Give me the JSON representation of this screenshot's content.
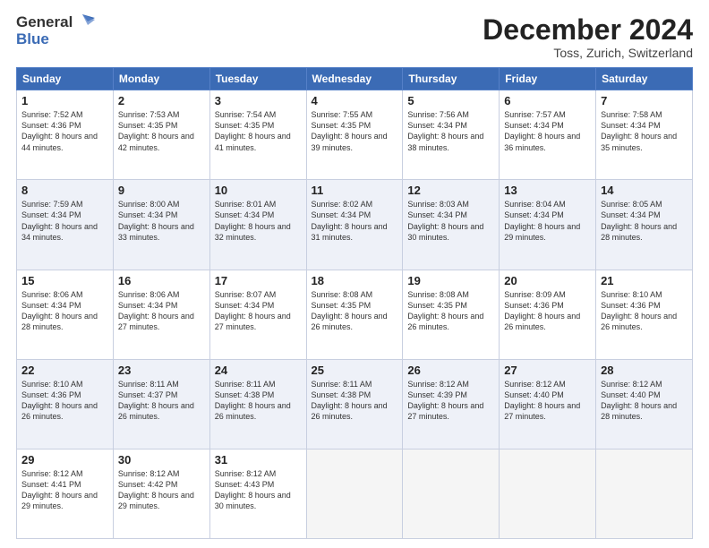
{
  "logo": {
    "line1": "General",
    "line2": "Blue"
  },
  "header": {
    "month": "December 2024",
    "location": "Toss, Zurich, Switzerland"
  },
  "weekdays": [
    "Sunday",
    "Monday",
    "Tuesday",
    "Wednesday",
    "Thursday",
    "Friday",
    "Saturday"
  ],
  "weeks": [
    [
      {
        "day": "1",
        "sunrise": "7:52 AM",
        "sunset": "4:36 PM",
        "daylight": "8 hours and 44 minutes."
      },
      {
        "day": "2",
        "sunrise": "7:53 AM",
        "sunset": "4:35 PM",
        "daylight": "8 hours and 42 minutes."
      },
      {
        "day": "3",
        "sunrise": "7:54 AM",
        "sunset": "4:35 PM",
        "daylight": "8 hours and 41 minutes."
      },
      {
        "day": "4",
        "sunrise": "7:55 AM",
        "sunset": "4:35 PM",
        "daylight": "8 hours and 39 minutes."
      },
      {
        "day": "5",
        "sunrise": "7:56 AM",
        "sunset": "4:34 PM",
        "daylight": "8 hours and 38 minutes."
      },
      {
        "day": "6",
        "sunrise": "7:57 AM",
        "sunset": "4:34 PM",
        "daylight": "8 hours and 36 minutes."
      },
      {
        "day": "7",
        "sunrise": "7:58 AM",
        "sunset": "4:34 PM",
        "daylight": "8 hours and 35 minutes."
      }
    ],
    [
      {
        "day": "8",
        "sunrise": "7:59 AM",
        "sunset": "4:34 PM",
        "daylight": "8 hours and 34 minutes."
      },
      {
        "day": "9",
        "sunrise": "8:00 AM",
        "sunset": "4:34 PM",
        "daylight": "8 hours and 33 minutes."
      },
      {
        "day": "10",
        "sunrise": "8:01 AM",
        "sunset": "4:34 PM",
        "daylight": "8 hours and 32 minutes."
      },
      {
        "day": "11",
        "sunrise": "8:02 AM",
        "sunset": "4:34 PM",
        "daylight": "8 hours and 31 minutes."
      },
      {
        "day": "12",
        "sunrise": "8:03 AM",
        "sunset": "4:34 PM",
        "daylight": "8 hours and 30 minutes."
      },
      {
        "day": "13",
        "sunrise": "8:04 AM",
        "sunset": "4:34 PM",
        "daylight": "8 hours and 29 minutes."
      },
      {
        "day": "14",
        "sunrise": "8:05 AM",
        "sunset": "4:34 PM",
        "daylight": "8 hours and 28 minutes."
      }
    ],
    [
      {
        "day": "15",
        "sunrise": "8:06 AM",
        "sunset": "4:34 PM",
        "daylight": "8 hours and 28 minutes."
      },
      {
        "day": "16",
        "sunrise": "8:06 AM",
        "sunset": "4:34 PM",
        "daylight": "8 hours and 27 minutes."
      },
      {
        "day": "17",
        "sunrise": "8:07 AM",
        "sunset": "4:34 PM",
        "daylight": "8 hours and 27 minutes."
      },
      {
        "day": "18",
        "sunrise": "8:08 AM",
        "sunset": "4:35 PM",
        "daylight": "8 hours and 26 minutes."
      },
      {
        "day": "19",
        "sunrise": "8:08 AM",
        "sunset": "4:35 PM",
        "daylight": "8 hours and 26 minutes."
      },
      {
        "day": "20",
        "sunrise": "8:09 AM",
        "sunset": "4:36 PM",
        "daylight": "8 hours and 26 minutes."
      },
      {
        "day": "21",
        "sunrise": "8:10 AM",
        "sunset": "4:36 PM",
        "daylight": "8 hours and 26 minutes."
      }
    ],
    [
      {
        "day": "22",
        "sunrise": "8:10 AM",
        "sunset": "4:36 PM",
        "daylight": "8 hours and 26 minutes."
      },
      {
        "day": "23",
        "sunrise": "8:11 AM",
        "sunset": "4:37 PM",
        "daylight": "8 hours and 26 minutes."
      },
      {
        "day": "24",
        "sunrise": "8:11 AM",
        "sunset": "4:38 PM",
        "daylight": "8 hours and 26 minutes."
      },
      {
        "day": "25",
        "sunrise": "8:11 AM",
        "sunset": "4:38 PM",
        "daylight": "8 hours and 26 minutes."
      },
      {
        "day": "26",
        "sunrise": "8:12 AM",
        "sunset": "4:39 PM",
        "daylight": "8 hours and 27 minutes."
      },
      {
        "day": "27",
        "sunrise": "8:12 AM",
        "sunset": "4:40 PM",
        "daylight": "8 hours and 27 minutes."
      },
      {
        "day": "28",
        "sunrise": "8:12 AM",
        "sunset": "4:40 PM",
        "daylight": "8 hours and 28 minutes."
      }
    ],
    [
      {
        "day": "29",
        "sunrise": "8:12 AM",
        "sunset": "4:41 PM",
        "daylight": "8 hours and 29 minutes."
      },
      {
        "day": "30",
        "sunrise": "8:12 AM",
        "sunset": "4:42 PM",
        "daylight": "8 hours and 29 minutes."
      },
      {
        "day": "31",
        "sunrise": "8:12 AM",
        "sunset": "4:43 PM",
        "daylight": "8 hours and 30 minutes."
      },
      null,
      null,
      null,
      null
    ]
  ]
}
